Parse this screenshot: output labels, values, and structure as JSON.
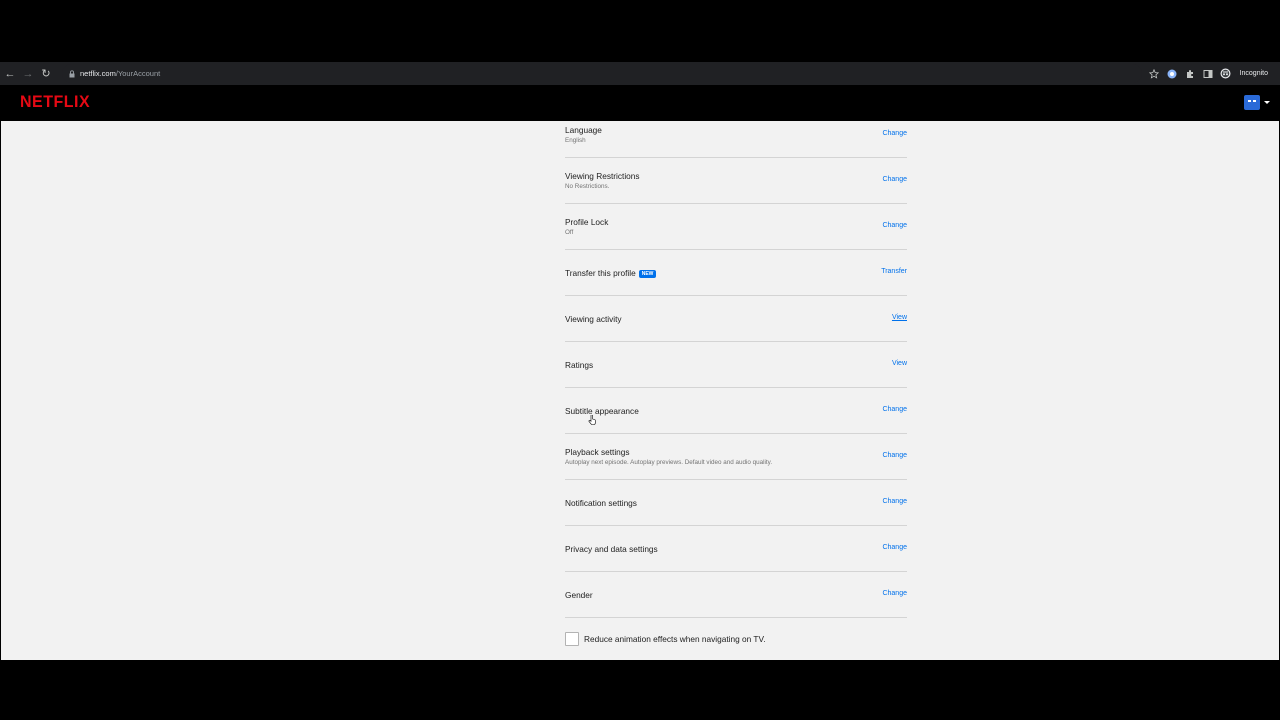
{
  "browser": {
    "url_host": "netflix.com",
    "url_path": "/YourAccount",
    "incognito_label": "Incognito"
  },
  "header": {
    "logo": "NETFLIX"
  },
  "settings": [
    {
      "title": "Language",
      "subtitle": "English",
      "action": "Change"
    },
    {
      "title": "Viewing Restrictions",
      "subtitle": "No Restrictions.",
      "action": "Change"
    },
    {
      "title": "Profile Lock",
      "subtitle": "Off",
      "action": "Change"
    },
    {
      "title": "Transfer this profile",
      "badge": "NEW",
      "action": "Transfer"
    },
    {
      "title": "Viewing activity",
      "action": "View"
    },
    {
      "title": "Ratings",
      "action": "View"
    },
    {
      "title": "Subtitle appearance",
      "action": "Change"
    },
    {
      "title": "Playback settings",
      "subtitle": "Autoplay next episode. Autoplay previews. Default video and audio quality.",
      "action": "Change"
    },
    {
      "title": "Notification settings",
      "action": "Change"
    },
    {
      "title": "Privacy and data settings",
      "action": "Change"
    },
    {
      "title": "Gender",
      "action": "Change"
    }
  ],
  "reduce_animation": {
    "label": "Reduce animation effects when navigating on TV.",
    "checked": false
  },
  "colors": {
    "netflix_red": "#e50914",
    "link_blue": "#0071eb",
    "page_bg": "#f2f2f2"
  }
}
